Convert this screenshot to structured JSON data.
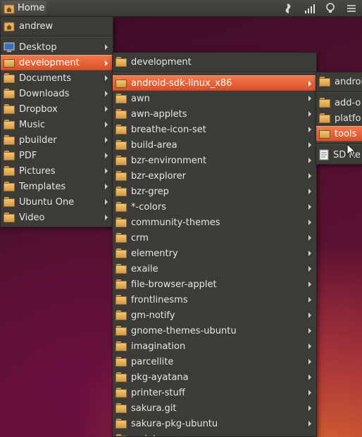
{
  "topbar": {
    "home_label": "Home",
    "tray_icons": [
      "dropbox-icon",
      "signal-icon",
      "lightbulb-icon",
      "menu-icon"
    ]
  },
  "places_menu": {
    "user_item": "andrew",
    "items": [
      "Desktop",
      "development",
      "Documents",
      "Downloads",
      "Dropbox",
      "Music",
      "pbuilder",
      "PDF",
      "Pictures",
      "Templates",
      "Ubuntu One",
      "Video"
    ],
    "selected": "development"
  },
  "development_menu": {
    "header_item": "development",
    "items": [
      "android-sdk-linux_x86",
      "awn",
      "awn-applets",
      "breathe-icon-set",
      "build-area",
      "bzr-environment",
      "bzr-explorer",
      "bzr-grep",
      "*-colors",
      "community-themes",
      "crm",
      "elementry",
      "exaile",
      "file-browser-applet",
      "frontlinesms",
      "gm-notify",
      "gnome-themes-ubuntu",
      "imagination",
      "parcellite",
      "pkg-ayatana",
      "printer-stuff",
      "sakura.git",
      "sakura-pkg-ubuntu",
      "scripts"
    ],
    "selected": "android-sdk-linux_x86"
  },
  "android_menu": {
    "header_item": "android",
    "items": [
      "add-o",
      "platfo",
      "tools"
    ],
    "file_item": "SD Re",
    "selected": "tools"
  }
}
